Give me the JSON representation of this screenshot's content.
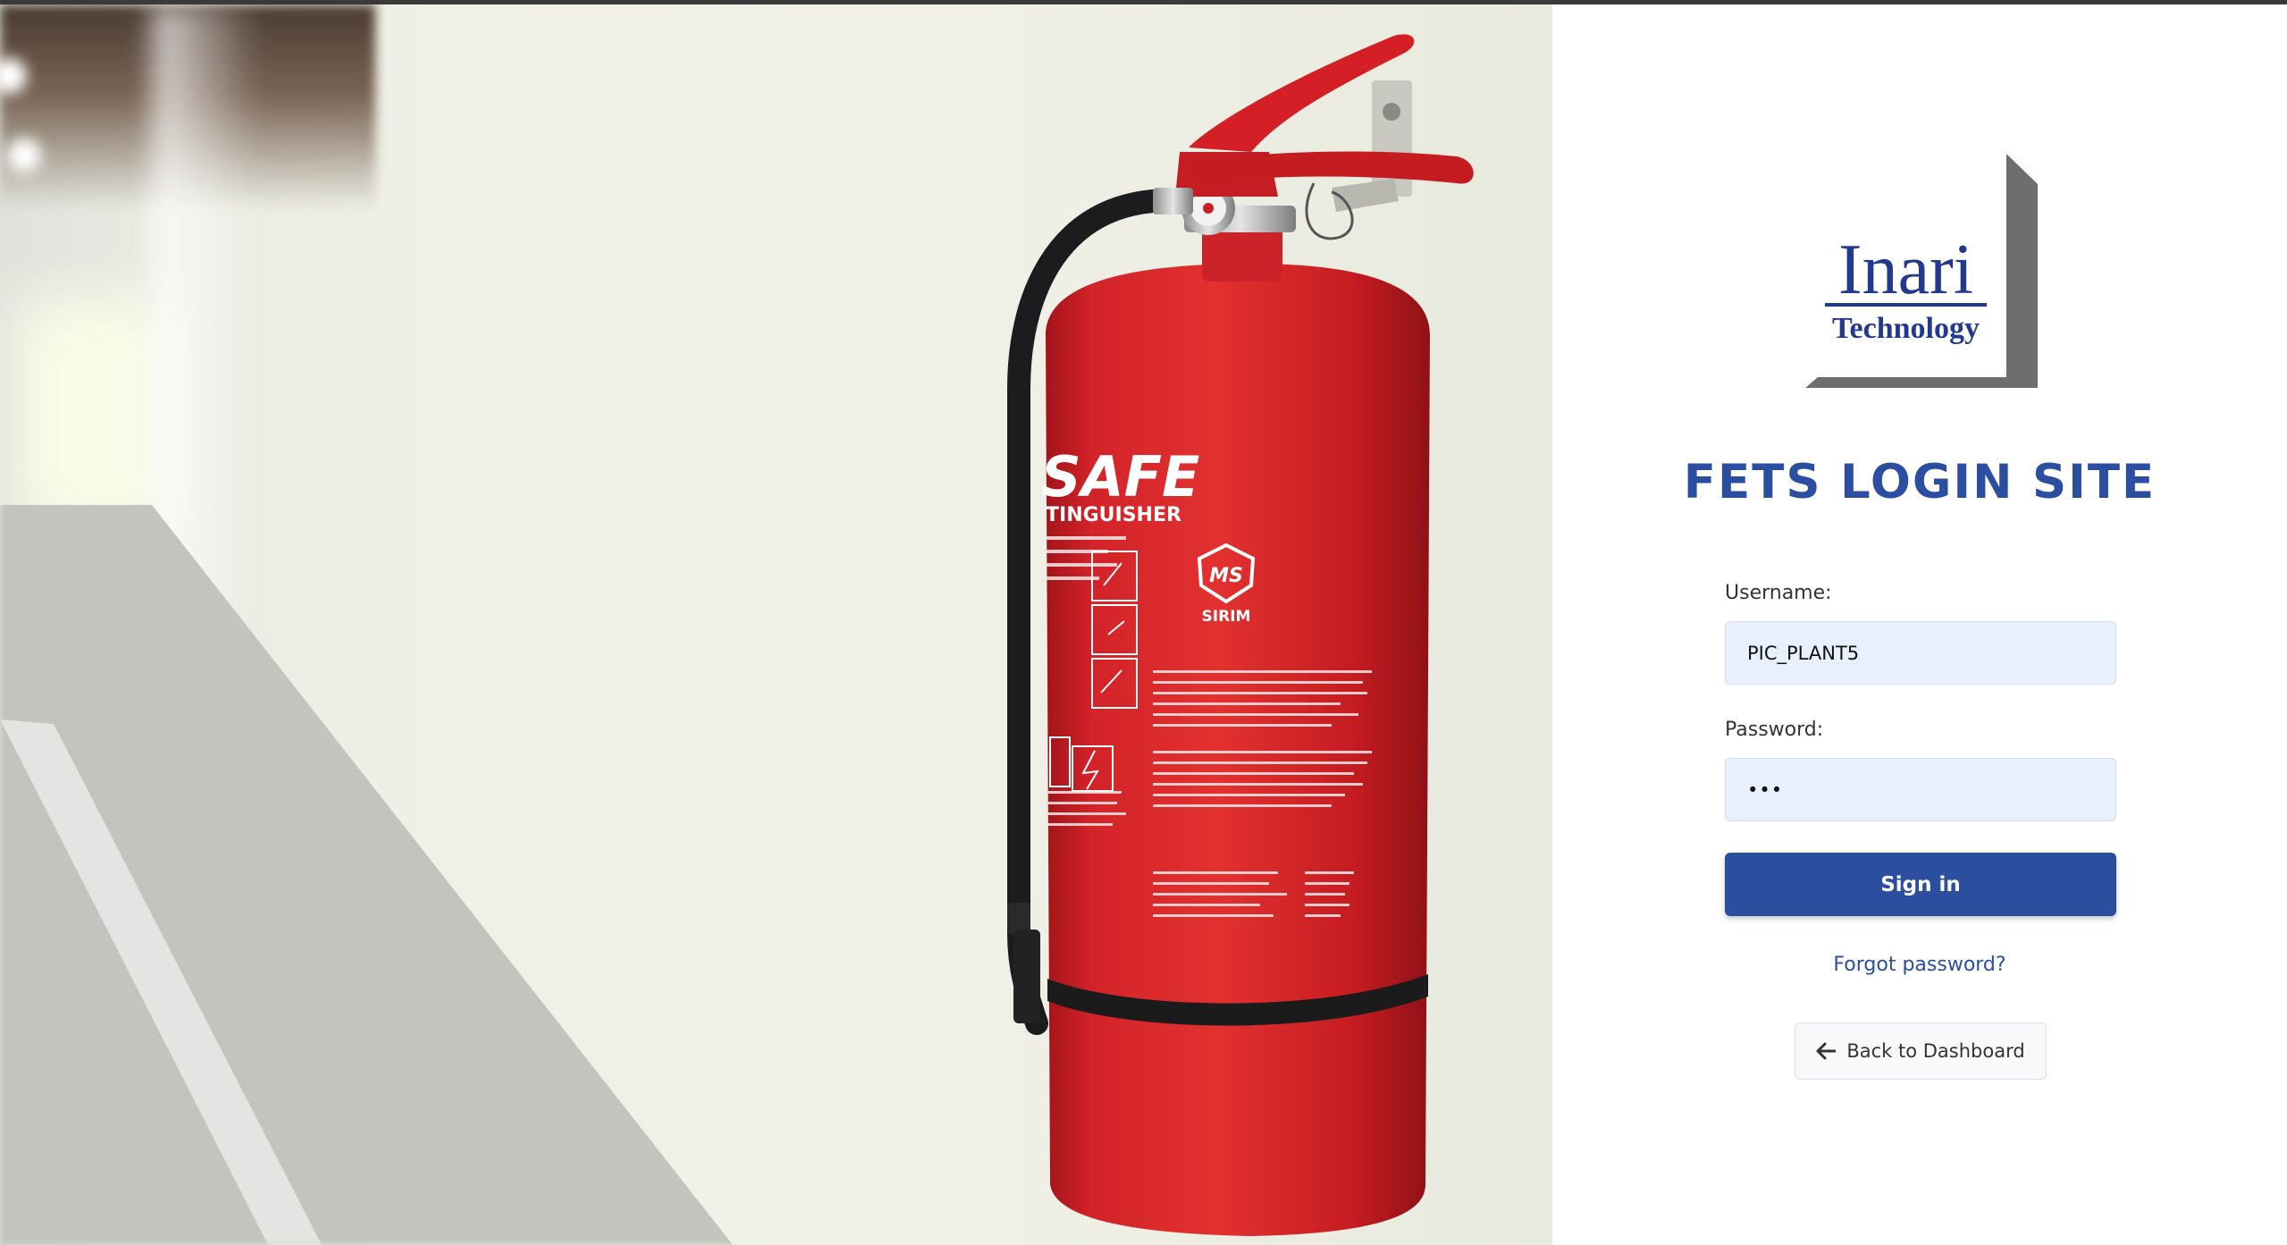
{
  "hero": {
    "image_description_icon": "fire-extinguisher-icon",
    "extinguisher_label": "SAFE",
    "extinguisher_subtitle": "TINGUISHER",
    "certification_mark": "MS",
    "certification_body": "SIRIM"
  },
  "logo": {
    "word": "Inari",
    "sub": "Technology"
  },
  "login": {
    "title": "FETS LOGIN SITE",
    "username_label": "Username:",
    "username_value": "PIC_PLANT5",
    "password_label": "Password:",
    "password_value": "•••",
    "signin_label": "Sign in",
    "forgot_label": "Forgot password?",
    "back_label": "Back to Dashboard",
    "back_icon": "arrow-left-icon"
  },
  "colors": {
    "accent": "#2b4ea1",
    "button": "#2c4e9e",
    "input_bg": "#e8f0fe",
    "logo_blue": "#22398e",
    "logo_shadow": "#6d6e70",
    "extinguisher_red": "#d41f26"
  }
}
